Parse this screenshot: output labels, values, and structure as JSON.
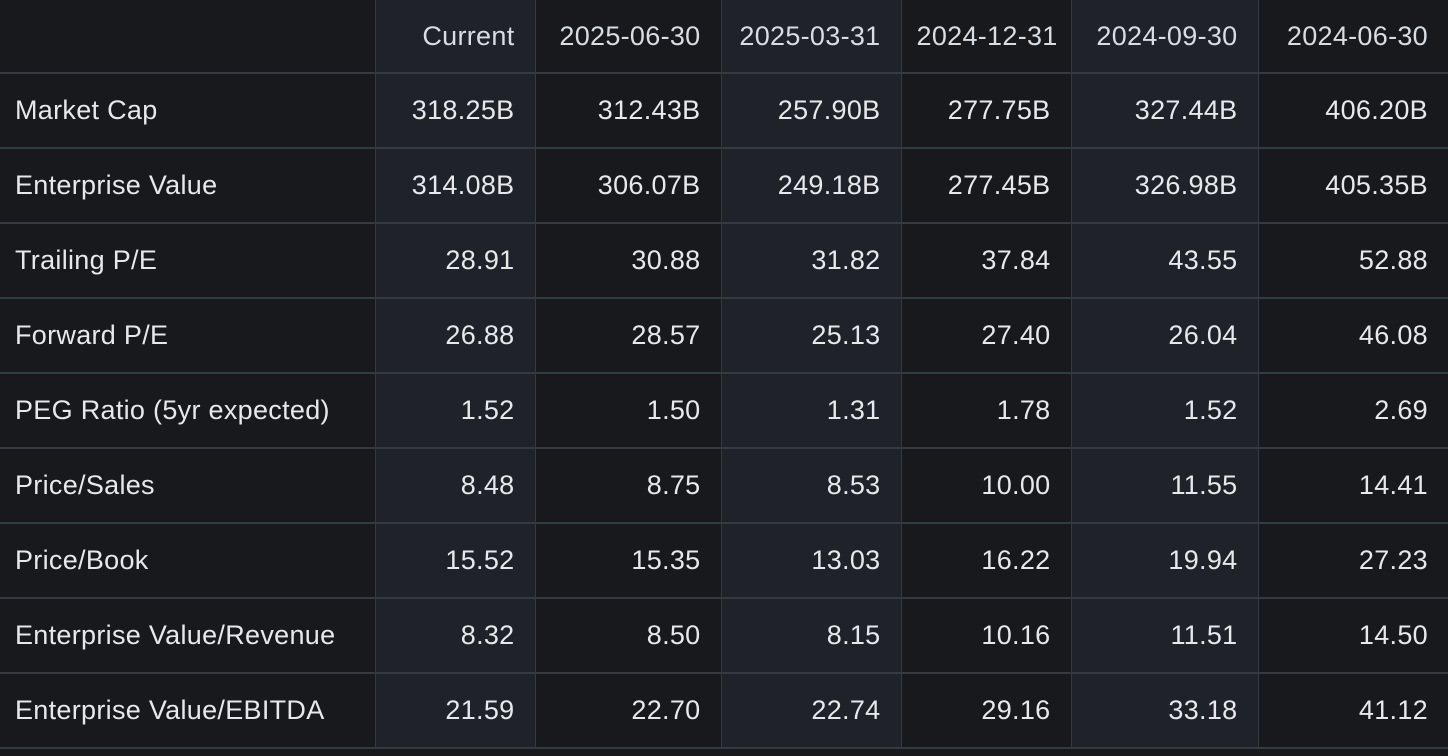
{
  "columns": [
    "",
    "Current",
    "2025-06-30",
    "2025-03-31",
    "2024-12-31",
    "2024-09-30",
    "2024-06-30"
  ],
  "rows": [
    {
      "label": "Market Cap",
      "values": [
        "318.25B",
        "312.43B",
        "257.90B",
        "277.75B",
        "327.44B",
        "406.20B"
      ]
    },
    {
      "label": "Enterprise Value",
      "values": [
        "314.08B",
        "306.07B",
        "249.18B",
        "277.45B",
        "326.98B",
        "405.35B"
      ]
    },
    {
      "label": "Trailing P/E",
      "values": [
        "28.91",
        "30.88",
        "31.82",
        "37.84",
        "43.55",
        "52.88"
      ]
    },
    {
      "label": "Forward P/E",
      "values": [
        "26.88",
        "28.57",
        "25.13",
        "27.40",
        "26.04",
        "46.08"
      ]
    },
    {
      "label": "PEG Ratio (5yr expected)",
      "values": [
        "1.52",
        "1.50",
        "1.31",
        "1.78",
        "1.52",
        "2.69"
      ]
    },
    {
      "label": "Price/Sales",
      "values": [
        "8.48",
        "8.75",
        "8.53",
        "10.00",
        "11.55",
        "14.41"
      ]
    },
    {
      "label": "Price/Book",
      "values": [
        "15.52",
        "15.35",
        "13.03",
        "16.22",
        "19.94",
        "27.23"
      ]
    },
    {
      "label": "Enterprise Value/Revenue",
      "values": [
        "8.32",
        "8.50",
        "8.15",
        "10.16",
        "11.51",
        "14.50"
      ]
    },
    {
      "label": "Enterprise Value/EBITDA",
      "values": [
        "21.59",
        "22.70",
        "22.74",
        "29.16",
        "33.18",
        "41.12"
      ]
    }
  ],
  "colors": {
    "background": "#17191d",
    "column_shade": "#1f2329",
    "border": "#343a42",
    "text": "#e6e8eb"
  }
}
